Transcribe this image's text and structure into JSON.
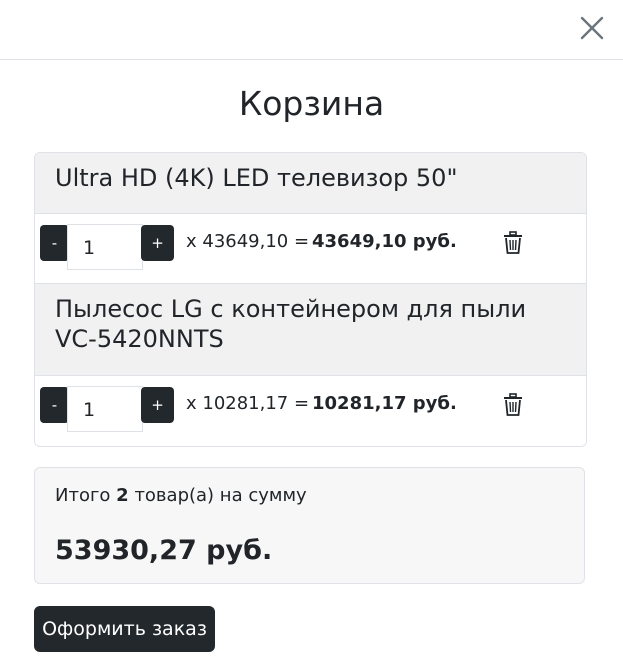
{
  "modal": {
    "title": "Корзина",
    "close_icon": "close-icon"
  },
  "cart": {
    "items": [
      {
        "name": "Ultra HD (4K) LED телевизор 50\"",
        "quantity": "1",
        "price_text": "x 43649,10 =",
        "line_total": "43649,10 руб.",
        "minus_label": "-",
        "plus_label": "+",
        "remove_icon": "trash-icon"
      },
      {
        "name": "Пылесос LG с контейнером для пыли VC-5420NNTS",
        "quantity": "1",
        "price_text": "x 10281,17 =",
        "line_total": "10281,17 руб.",
        "minus_label": "-",
        "plus_label": "+",
        "remove_icon": "trash-icon"
      }
    ]
  },
  "summary": {
    "prefix": "Итого",
    "count": "2",
    "suffix": "товар(а) на сумму",
    "total": "53930,27 руб."
  },
  "checkout": {
    "label": "Оформить заказ"
  },
  "colors": {
    "button_dark": "#23282c",
    "header_bg": "#f1f1f2",
    "summary_bg": "#f7f7f7",
    "border": "#dfe2e6"
  }
}
